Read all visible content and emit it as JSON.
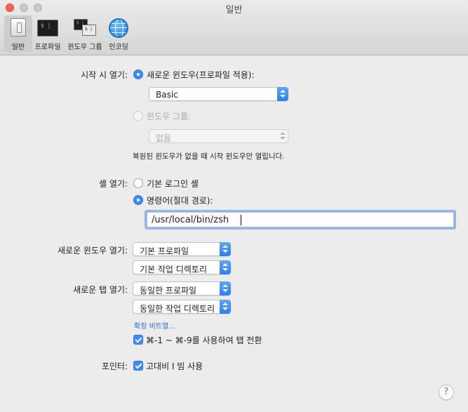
{
  "window": {
    "title": "일반"
  },
  "toolbar": {
    "items": [
      {
        "label": "일반",
        "active": true
      },
      {
        "label": "프로파일",
        "glyph": "$ |"
      },
      {
        "label": "윈도우 그룹",
        "glyph_a": "$ |",
        "glyph_b": "$ |"
      },
      {
        "label": "인코딩"
      }
    ]
  },
  "startup": {
    "label": "시작 시 열기:",
    "new_window_option": "새로운 윈도우(프로파일 적용):",
    "new_window_profile": "Basic",
    "window_group_option": "윈도우 그룹:",
    "window_group_value": "없음",
    "note": "복원된 윈도우가 없을 때 시작 윈도우만 열립니다."
  },
  "shell": {
    "label": "셸 열기:",
    "default_login_option": "기본 로그인 셸",
    "command_option": "명령어(절대 경로):",
    "command_value": "/usr/local/bin/zsh"
  },
  "new_window": {
    "label": "새로운 윈도우 열기:",
    "profile": "기본 프로파일",
    "directory": "기본 작업 디렉토리"
  },
  "new_tab": {
    "label": "새로운 탭 열기:",
    "profile": "동일한 프로파일",
    "directory": "동일한 작업 디렉토리",
    "extension_link": "확장 비트열...",
    "tab_switch_checkbox": "⌘-1 ~ ⌘-9를 사용하여 탭 전환"
  },
  "pointer": {
    "label": "포인터:",
    "high_contrast_checkbox": "고대비 I 빔 사용"
  },
  "help": {
    "glyph": "?"
  },
  "colors": {
    "accent": "#3f8cf5",
    "link": "#2d64d6",
    "background": "#ececec"
  }
}
